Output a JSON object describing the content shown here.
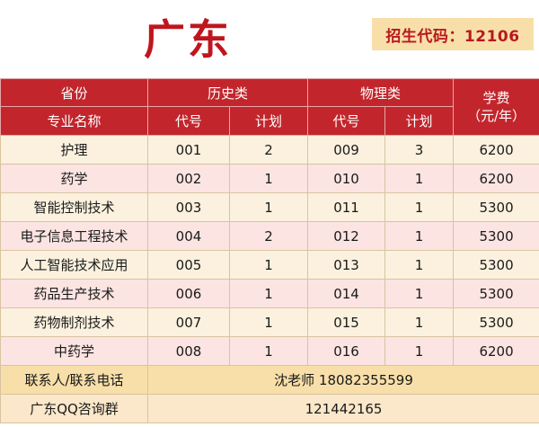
{
  "title": "广东",
  "enroll_code_label": "招生代码：12106",
  "headers": {
    "province": "省份",
    "history": "历史类",
    "physics": "物理类",
    "fee": "学费\n（元/年）",
    "major": "专业名称",
    "code": "代号",
    "plan": "计划"
  },
  "rows": [
    {
      "major": "护理",
      "hist_code": "001",
      "hist_plan": "2",
      "phys_code": "009",
      "phys_plan": "3",
      "fee": "6200"
    },
    {
      "major": "药学",
      "hist_code": "002",
      "hist_plan": "1",
      "phys_code": "010",
      "phys_plan": "1",
      "fee": "6200"
    },
    {
      "major": "智能控制技术",
      "hist_code": "003",
      "hist_plan": "1",
      "phys_code": "011",
      "phys_plan": "1",
      "fee": "5300"
    },
    {
      "major": "电子信息工程技术",
      "hist_code": "004",
      "hist_plan": "2",
      "phys_code": "012",
      "phys_plan": "1",
      "fee": "5300"
    },
    {
      "major": "人工智能技术应用",
      "hist_code": "005",
      "hist_plan": "1",
      "phys_code": "013",
      "phys_plan": "1",
      "fee": "5300"
    },
    {
      "major": "药品生产技术",
      "hist_code": "006",
      "hist_plan": "1",
      "phys_code": "014",
      "phys_plan": "1",
      "fee": "5300"
    },
    {
      "major": "药物制剂技术",
      "hist_code": "007",
      "hist_plan": "1",
      "phys_code": "015",
      "phys_plan": "1",
      "fee": "5300"
    },
    {
      "major": "中药学",
      "hist_code": "008",
      "hist_plan": "1",
      "phys_code": "016",
      "phys_plan": "1",
      "fee": "6200"
    }
  ],
  "footer": {
    "contact_label": "联系人/联系电话",
    "contact_value": "沈老师 18082355599",
    "qq_label": "广东QQ咨询群",
    "qq_value": "121442165"
  },
  "colors": {
    "title_red": "#c0151e",
    "header_red": "#c2262c",
    "code_box": "#f8dfa9"
  }
}
